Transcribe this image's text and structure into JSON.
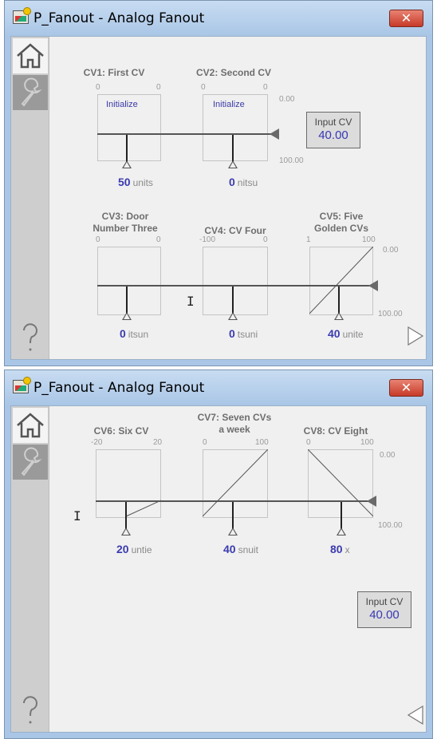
{
  "windows": [
    {
      "title": "P_Fanout - Analog Fanout",
      "close": "✕",
      "input_cv": {
        "label": "Input CV",
        "value": "40.00"
      },
      "scale_top": "0.00",
      "scale_bottom": "100.00",
      "scale_top_2": "0.00",
      "scale_bottom_2": "100.00",
      "nav_arrow": "next",
      "cvs": [
        {
          "title": "CV1: First CV",
          "min": "0",
          "max": "0",
          "button": "Initialize",
          "value": "50",
          "units": "units",
          "line": "flat"
        },
        {
          "title": "CV2: Second CV",
          "min": "0",
          "max": "0",
          "button": "Initialize",
          "value": "0",
          "units": "nitsu",
          "line": "flat"
        },
        {
          "title": "CV3: Door\nNumber Three",
          "min": "0",
          "max": "0",
          "value": "0",
          "units": "itsun",
          "line": "flat"
        },
        {
          "title": "CV4: CV Four",
          "min": "-100",
          "max": "0",
          "value": "0",
          "units": "tsuni",
          "line": "flat"
        },
        {
          "title": "CV5: Five\nGolden CVs",
          "min": "1",
          "max": "100",
          "value": "40",
          "units": "unite",
          "line": "rising"
        }
      ]
    },
    {
      "title": "P_Fanout - Analog Fanout",
      "close": "✕",
      "input_cv": {
        "label": "Input CV",
        "value": "40.00"
      },
      "scale_top": "0.00",
      "scale_bottom": "100.00",
      "nav_arrow": "previous",
      "cvs": [
        {
          "title": "CV6: Six CV",
          "min": "-20",
          "max": "20",
          "value": "20",
          "units": "untie",
          "line": "low-rising"
        },
        {
          "title": "CV7: Seven CVs\na week",
          "min": "0",
          "max": "100",
          "value": "40",
          "units": "snuit",
          "line": "rising"
        },
        {
          "title": "CV8: CV Eight",
          "min": "0",
          "max": "100",
          "value": "80",
          "units": "x",
          "line": "falling"
        }
      ]
    }
  ],
  "colors": {
    "titlebar": "#a9c6e6",
    "close": "#c73a28",
    "value_text": "#3b3bb0",
    "panel": "#f0f0f0"
  },
  "icons": [
    "app-icon",
    "close-icon",
    "home-icon",
    "wrench-icon",
    "help-icon",
    "next-arrow-icon",
    "previous-arrow-icon",
    "ibeam-cursor-icon"
  ]
}
